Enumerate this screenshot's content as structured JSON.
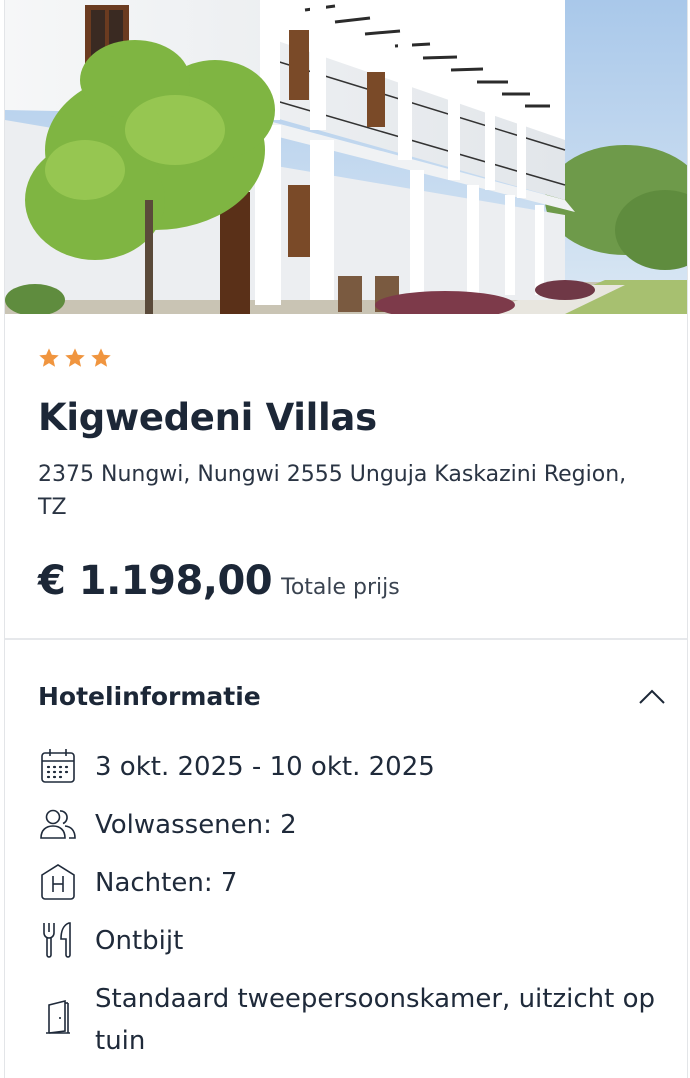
{
  "hotel": {
    "stars": 3,
    "star_color": "#f0953f",
    "name": "Kigwedeni Villas",
    "address": "2375 Nungwi, Nungwi 2555 Unguja Kaskazini Region, TZ"
  },
  "price": {
    "amount": "€ 1.198,00",
    "label": "Totale prijs"
  },
  "info_section": {
    "title": "Hotelinformatie",
    "toggle_icon": "chevron-up-icon",
    "items": [
      {
        "icon": "calendar-icon",
        "text": "3 okt. 2025 - 10 okt. 2025"
      },
      {
        "icon": "people-icon",
        "text": "Volwassenen: 2"
      },
      {
        "icon": "hotel-icon",
        "text": "Nachten: 7"
      },
      {
        "icon": "cutlery-icon",
        "text": "Ontbijt"
      },
      {
        "icon": "door-icon",
        "text": "Standaard tweepersoonskamer, uitzicht op tuin"
      }
    ]
  }
}
